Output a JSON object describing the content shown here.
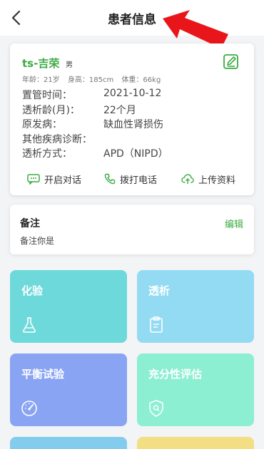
{
  "header": {
    "title": "患者信息"
  },
  "patient": {
    "name": "ts-吉荣",
    "gender": "男",
    "age": "年龄：21岁",
    "height": "身高：185cm",
    "weight": "体重：66kg",
    "rows": [
      {
        "label": "置管时间：",
        "value": "2021-10-12"
      },
      {
        "label": "透析龄(月)：",
        "value": "22个月"
      },
      {
        "label": "原发病：",
        "value": "缺血性肾损伤"
      },
      {
        "label": "其他疾病诊断：",
        "value": ""
      },
      {
        "label": "透析方式：",
        "value": "APD（NIPD）"
      }
    ],
    "actions": {
      "chat": "开启对话",
      "call": "拨打电话",
      "upload": "上传资料"
    }
  },
  "notes": {
    "title": "备注",
    "edit": "编辑",
    "content": "备注你是"
  },
  "tiles": {
    "lab": "化验",
    "dialysis": "透析",
    "balance": "平衡试验",
    "adequacy": "充分性评估"
  },
  "colors": {
    "accent": "#3cab43",
    "tile_lab": "#6ed9da",
    "tile_dialysis": "#93dbf3",
    "tile_balance": "#8aa4f4",
    "tile_adequacy": "#8cefd1",
    "annotation_arrow": "#e8161a"
  }
}
